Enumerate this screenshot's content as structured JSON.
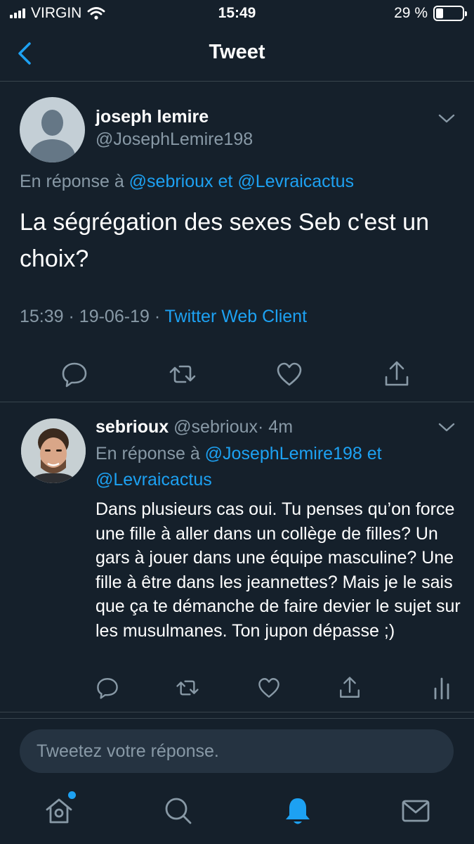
{
  "status_bar": {
    "carrier": "VIRGIN",
    "time": "15:49",
    "battery_text": "29 %",
    "battery_level": 0.29
  },
  "nav": {
    "title": "Tweet"
  },
  "main_tweet": {
    "display_name": "joseph lemire",
    "handle": "@JosephLemire198",
    "reply_prefix": "En réponse à",
    "reply_user_1": "@sebrioux",
    "reply_joiner": "et",
    "reply_user_2": "@Levraicactus",
    "text": "La ségrégation des sexes Seb c'est un choix?",
    "time": "15:39",
    "sep": "·",
    "date": "19-06-19",
    "client": "Twitter Web Client"
  },
  "reply_tweet": {
    "display_name": "sebrioux",
    "handle": "@sebrioux",
    "age": "· 4m",
    "reply_prefix": "En réponse à",
    "reply_user_1": "@JosephLemire198",
    "reply_joiner": "et",
    "reply_user_2": "@Levraicactus",
    "text": "Dans plusieurs cas oui. Tu penses qu’on force une fille à aller dans un collège de filles?  Un gars à jouer dans une équipe masculine? Une fille à être dans les jeannettes? Mais je le sais que ça te démanche de faire devier le sujet sur les musulmanes. Ton jupon dépasse ;)"
  },
  "compose": {
    "placeholder": "Tweetez votre réponse."
  },
  "colors": {
    "background": "#15202b",
    "accent": "#1da1f2",
    "secondary_text": "#8899a6",
    "divider": "#38444d"
  },
  "icons": {
    "back": "chevron-left-icon",
    "reply": "comment-icon",
    "retweet": "retweet-icon",
    "like": "heart-icon",
    "share": "share-icon",
    "analytics": "bar-chart-icon",
    "home": "home-icon",
    "search": "search-icon",
    "notifications": "bell-icon",
    "messages": "mail-icon"
  }
}
